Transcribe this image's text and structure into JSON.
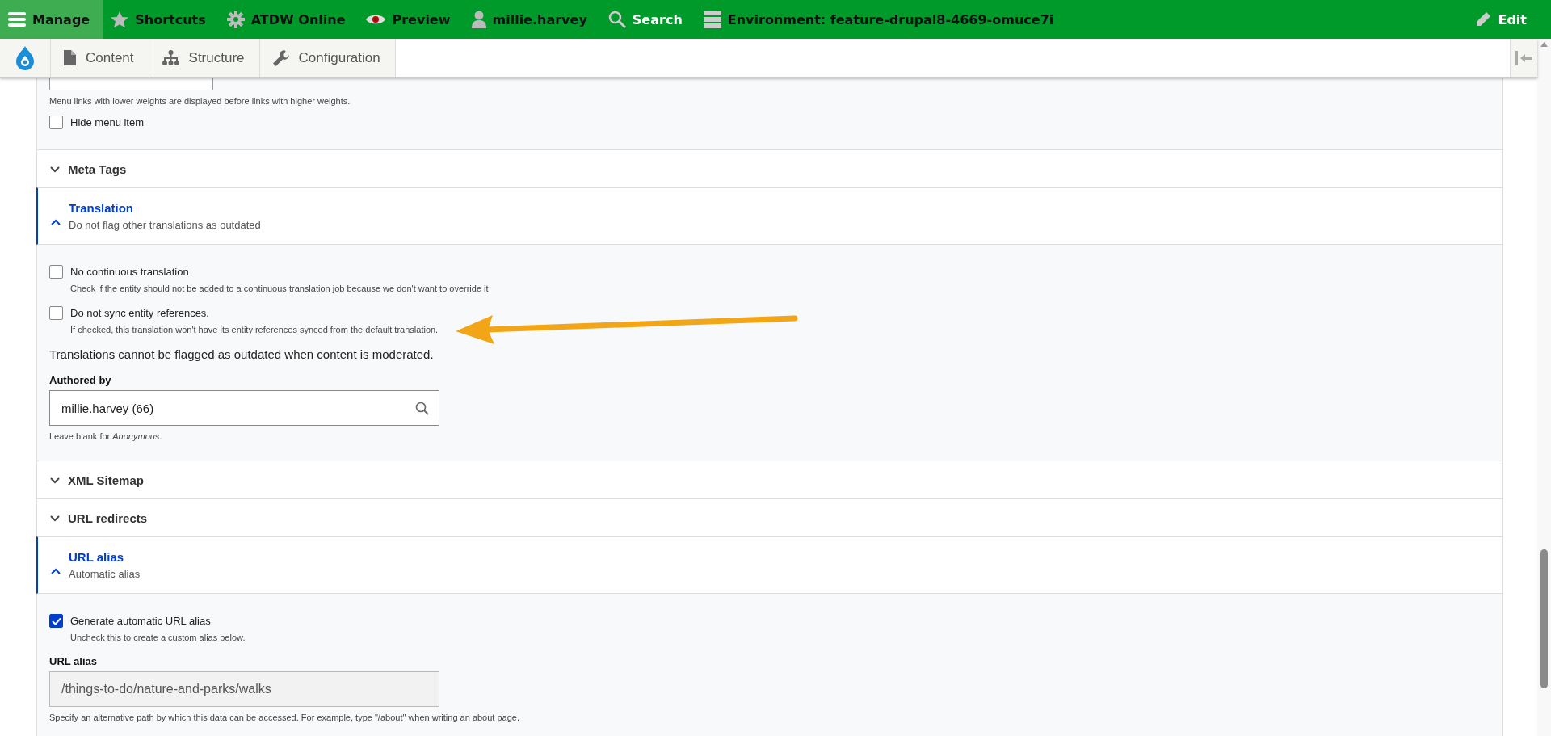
{
  "toolbar": {
    "items": [
      {
        "label": "Manage",
        "selected": true
      },
      {
        "label": "Shortcuts",
        "selected": false
      },
      {
        "label": "ATDW Online",
        "selected": false
      },
      {
        "label": "Preview",
        "selected": false
      },
      {
        "label": "millie.harvey",
        "selected": false
      },
      {
        "label": "Search",
        "selected": false
      },
      {
        "label": "Environment: feature-drupal8-4669-omuce7i",
        "selected": false
      }
    ],
    "edit": "Edit"
  },
  "tray": {
    "items": [
      {
        "label": "Content"
      },
      {
        "label": "Structure"
      },
      {
        "label": "Configuration"
      }
    ]
  },
  "form": {
    "partial_section": {
      "content": [
        {
          "kind": "field_edge",
          "description": "Menu links with lower weights are displayed before links with higher weights."
        },
        {
          "kind": "checkbox",
          "label": "Hide menu item",
          "checked": false
        }
      ]
    },
    "sections": [
      {
        "title": "Meta Tags",
        "expanded": false
      },
      {
        "title": "Translation",
        "expanded": true,
        "summary": "Do not flag other translations as outdated",
        "content": [
          {
            "kind": "checkbox",
            "label": "No continuous translation",
            "checked": false,
            "description": "Check if the entity should not be added to a continuous translation job because we don't want to override it"
          },
          {
            "kind": "checkbox",
            "label": "Do not sync entity references.",
            "checked": false,
            "description": "If checked, this translation won't have its entity references synced from the default translation."
          },
          {
            "kind": "note",
            "text": "Translations cannot be flagged as outdated when content is moderated."
          },
          {
            "kind": "autocomplete",
            "label": "Authored by",
            "value": "millie.harvey (66)",
            "disabled": false,
            "description": "Leave blank for *Anonymous*."
          }
        ]
      },
      {
        "title": "XML Sitemap",
        "expanded": false
      },
      {
        "title": "URL redirects",
        "expanded": false
      },
      {
        "title": "URL alias",
        "expanded": true,
        "summary": "Automatic alias",
        "content": [
          {
            "kind": "checkbox",
            "label": "Generate automatic URL alias",
            "checked": true,
            "description": "Uncheck this to create a custom alias below."
          },
          {
            "kind": "textfield",
            "label": "URL alias",
            "value": "/things-to-do/nature-and-parks/walks",
            "disabled": true,
            "description": "Specify an alternative path by which this data can be accessed. For example, type \"/about\" when writing an about page."
          }
        ]
      }
    ]
  }
}
